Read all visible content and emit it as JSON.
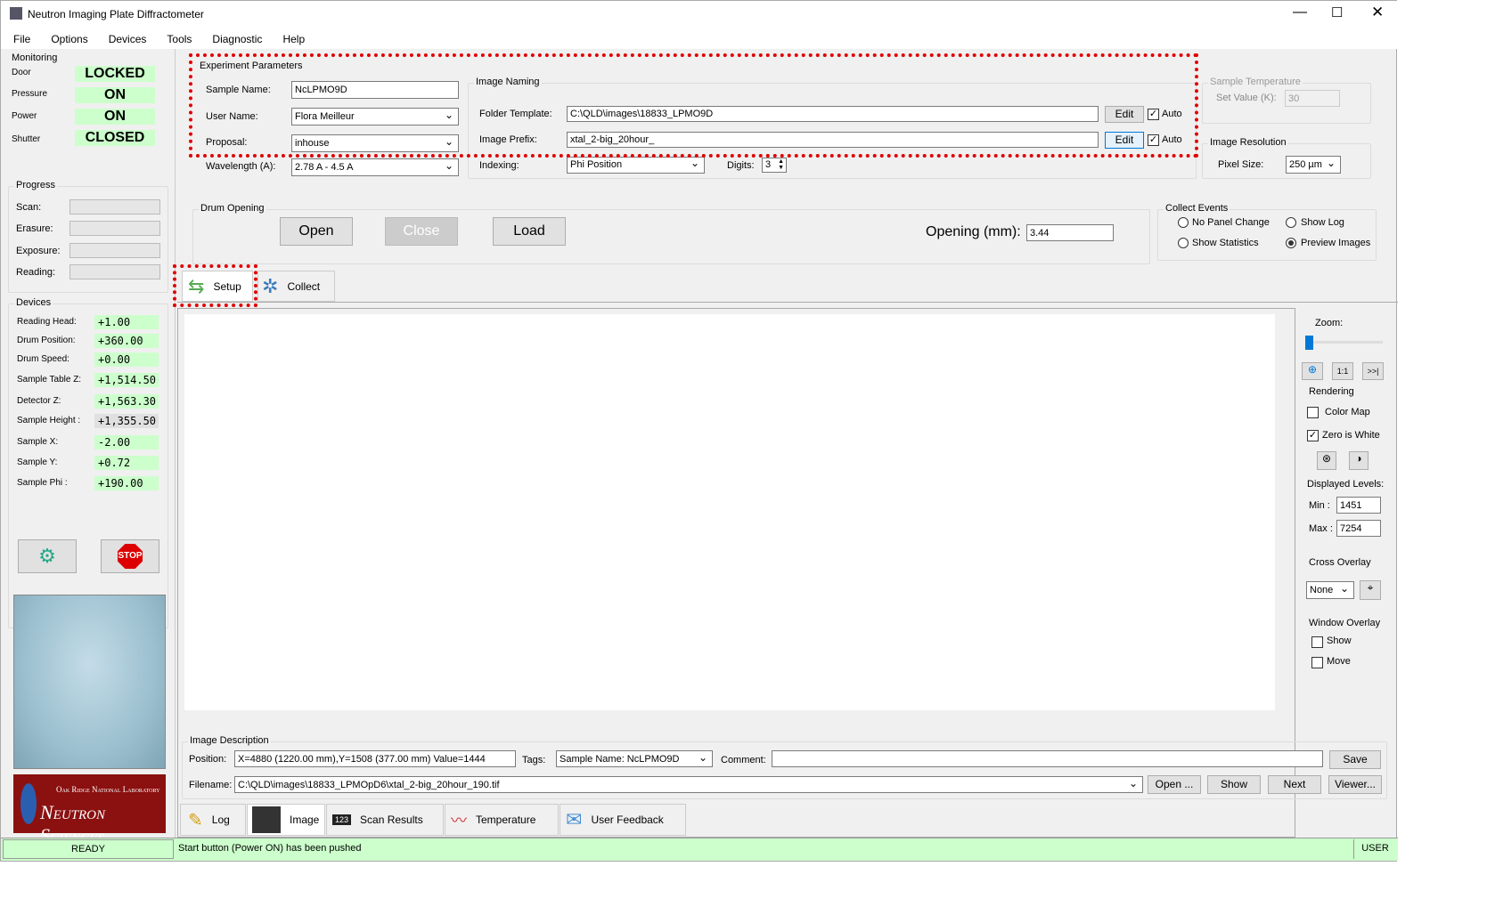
{
  "window": {
    "title": "Neutron Imaging Plate Diffractometer"
  },
  "menu": [
    "File",
    "Options",
    "Devices",
    "Tools",
    "Diagnostic",
    "Help"
  ],
  "monitoring": {
    "title": "Monitoring",
    "items": [
      {
        "label": "Door",
        "value": "LOCKED"
      },
      {
        "label": "Pressure",
        "value": "ON"
      },
      {
        "label": "Power",
        "value": "ON"
      },
      {
        "label": "Shutter",
        "value": "CLOSED"
      }
    ]
  },
  "progress": {
    "title": "Progress",
    "items": [
      "Scan:",
      "Erasure:",
      "Exposure:",
      "Reading:"
    ]
  },
  "devices": {
    "title": "Devices",
    "items": [
      {
        "label": "Reading Head:",
        "value": "+1.00"
      },
      {
        "label": "Drum Position:",
        "value": "+360.00"
      },
      {
        "label": "Drum Speed:",
        "value": "+0.00"
      },
      {
        "label": "Sample Table Z:",
        "value": "+1,514.50"
      },
      {
        "label": "Detector Z:",
        "value": "+1,563.30"
      },
      {
        "label": "Sample Height :",
        "value": "+1,355.50"
      },
      {
        "label": "Sample X:",
        "value": "-2.00"
      },
      {
        "label": "Sample Y:",
        "value": "+0.72"
      },
      {
        "label": "Sample Phi :",
        "value": "+190.00"
      }
    ]
  },
  "stop_label": "STOP",
  "logo": {
    "line1": "Oak Ridge National Laboratory",
    "line2": "Neutron Sciences"
  },
  "experiment": {
    "title": "Experiment Parameters",
    "sample_name_label": "Sample Name:",
    "sample_name": "NcLPMO9D",
    "user_name_label": "User Name:",
    "user_name": "Flora Meilleur",
    "proposal_label": "Proposal:",
    "proposal": "inhouse",
    "wavelength_label": "Wavelength (A):",
    "wavelength": "2.78 A - 4.5 A"
  },
  "naming": {
    "title": "Image Naming",
    "folder_label": "Folder Template:",
    "folder": "C:\\QLD\\images\\18833_LPMO9D",
    "prefix_label": "Image Prefix:",
    "prefix": "xtal_2-big_20hour_",
    "edit": "Edit",
    "auto": "Auto",
    "indexing_label": "Indexing:",
    "indexing": "Phi Position",
    "digits_label": "Digits:",
    "digits": "3"
  },
  "temperature": {
    "title": "Sample Temperature",
    "set_label": "Set Value (K):",
    "set_value": "30"
  },
  "resolution": {
    "title": "Image Resolution",
    "pixel_label": "Pixel Size:",
    "pixel_value": "250 µm"
  },
  "drum": {
    "title": "Drum Opening",
    "open": "Open",
    "close": "Close",
    "load": "Load",
    "opening_label": "Opening (mm):",
    "opening_value": "3.44"
  },
  "collect_events": {
    "title": "Collect Events",
    "options": [
      {
        "label": "No Panel Change",
        "on": false
      },
      {
        "label": "Show Log",
        "on": false
      },
      {
        "label": "Show Statistics",
        "on": false
      },
      {
        "label": "Preview Images",
        "on": true
      }
    ]
  },
  "tabs": {
    "setup": "Setup",
    "collect": "Collect"
  },
  "right": {
    "zoom_label": "Zoom:",
    "one_to_one": "1:1",
    "fit": ">>|",
    "rendering": "Rendering",
    "color_map": "Color Map",
    "zero_white": "Zero is White",
    "levels": "Displayed Levels:",
    "min_label": "Min :",
    "min": "1451",
    "max_label": "Max :",
    "max": "7254",
    "cross": "Cross Overlay",
    "cross_value": "None",
    "window_overlay": "Window Overlay",
    "show": "Show",
    "move": "Move"
  },
  "desc": {
    "title": "Image Description",
    "position_label": "Position:",
    "position": "X=4880 (1220.00 mm),Y=1508 (377.00 mm) Value=1444",
    "tags_label": "Tags:",
    "tags": "Sample Name: NcLPMO9D",
    "comment_label": "Comment:",
    "comment": "",
    "save": "Save",
    "filename_label": "Filename:",
    "filename": "C:\\QLD\\images\\18833_LPMOpD6\\xtal_2-big_20hour_190.tif",
    "open": "Open ...",
    "show": "Show",
    "next": "Next",
    "viewer": "Viewer..."
  },
  "bottom_tabs": [
    "Log",
    "Image",
    "Scan Results",
    "Temperature",
    "User Feedback"
  ],
  "status": {
    "state": "READY",
    "message": "Start button (Power ON) has been pushed",
    "role": "USER"
  }
}
